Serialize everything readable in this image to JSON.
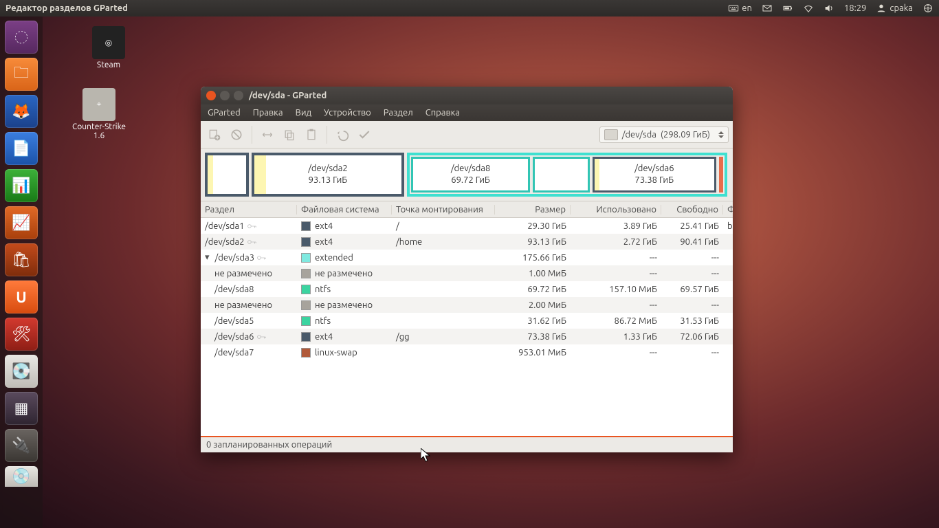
{
  "panel": {
    "title": "Редактор разделов GParted",
    "lang": "en",
    "time": "18:29",
    "user": "cpaka"
  },
  "desktop_icons": [
    {
      "label": "Steam"
    },
    {
      "label": "Counter-Strike 1.6"
    }
  ],
  "window": {
    "title": "/dev/sda - GParted",
    "menu": [
      "GParted",
      "Правка",
      "Вид",
      "Устройство",
      "Раздел",
      "Справка"
    ],
    "device_selector": {
      "device": "/dev/sda",
      "size": "(298.09 ГиБ)"
    },
    "diskmap": {
      "pre": {
        "label": "",
        "sub": ""
      },
      "sda2": {
        "label": "/dev/sda2",
        "sub": "93.13 ГиБ"
      },
      "sda8": {
        "label": "/dev/sda8",
        "sub": "69.72 ГиБ"
      },
      "gap": {
        "label": "",
        "sub": ""
      },
      "sda6": {
        "label": "/dev/sda6",
        "sub": "73.38 ГиБ"
      }
    },
    "columns": [
      "Раздел",
      "Файловая система",
      "Точка монтирования",
      "Размер",
      "Использовано",
      "Свободно",
      "Флаги"
    ],
    "rows": [
      {
        "part": "/dev/sda1",
        "key": true,
        "indent": 0,
        "fs": "ext4",
        "fscolor": "#4a5a6a",
        "mount": "/",
        "size": "29.30 ГиБ",
        "used": "3.89 ГиБ",
        "free": "25.41 ГиБ",
        "flags": "boot"
      },
      {
        "part": "/dev/sda2",
        "key": true,
        "indent": 0,
        "fs": "ext4",
        "fscolor": "#4a5a6a",
        "mount": "/home",
        "size": "93.13 ГиБ",
        "used": "2.72 ГиБ",
        "free": "90.41 ГиБ",
        "flags": ""
      },
      {
        "part": "/dev/sda3",
        "key": true,
        "indent": 0,
        "tri": true,
        "fs": "extended",
        "fscolor": "#7fe9e0",
        "mount": "",
        "size": "175.66 ГиБ",
        "used": "---",
        "free": "---",
        "flags": ""
      },
      {
        "part": "не размечено",
        "key": false,
        "indent": 1,
        "fs": "не размечено",
        "fscolor": "#a7a39c",
        "mount": "",
        "size": "1.00 МиБ",
        "used": "---",
        "free": "---",
        "flags": ""
      },
      {
        "part": "/dev/sda8",
        "key": false,
        "indent": 1,
        "fs": "ntfs",
        "fscolor": "#3bd4a0",
        "mount": "",
        "size": "69.72 ГиБ",
        "used": "157.10 МиБ",
        "free": "69.57 ГиБ",
        "flags": ""
      },
      {
        "part": "не размечено",
        "key": false,
        "indent": 1,
        "fs": "не размечено",
        "fscolor": "#a7a39c",
        "mount": "",
        "size": "2.00 МиБ",
        "used": "---",
        "free": "---",
        "flags": ""
      },
      {
        "part": "/dev/sda5",
        "key": false,
        "indent": 1,
        "fs": "ntfs",
        "fscolor": "#3bd4a0",
        "mount": "",
        "size": "31.62 ГиБ",
        "used": "86.72 МиБ",
        "free": "31.53 ГиБ",
        "flags": ""
      },
      {
        "part": "/dev/sda6",
        "key": true,
        "indent": 1,
        "fs": "ext4",
        "fscolor": "#4a5a6a",
        "mount": "/gg",
        "size": "73.38 ГиБ",
        "used": "1.33 ГиБ",
        "free": "72.06 ГиБ",
        "flags": ""
      },
      {
        "part": "/dev/sda7",
        "key": false,
        "indent": 1,
        "fs": "linux-swap",
        "fscolor": "#b15a3a",
        "mount": "",
        "size": "953.01 МиБ",
        "used": "---",
        "free": "---",
        "flags": ""
      }
    ],
    "status": "0 запланированных операций"
  }
}
